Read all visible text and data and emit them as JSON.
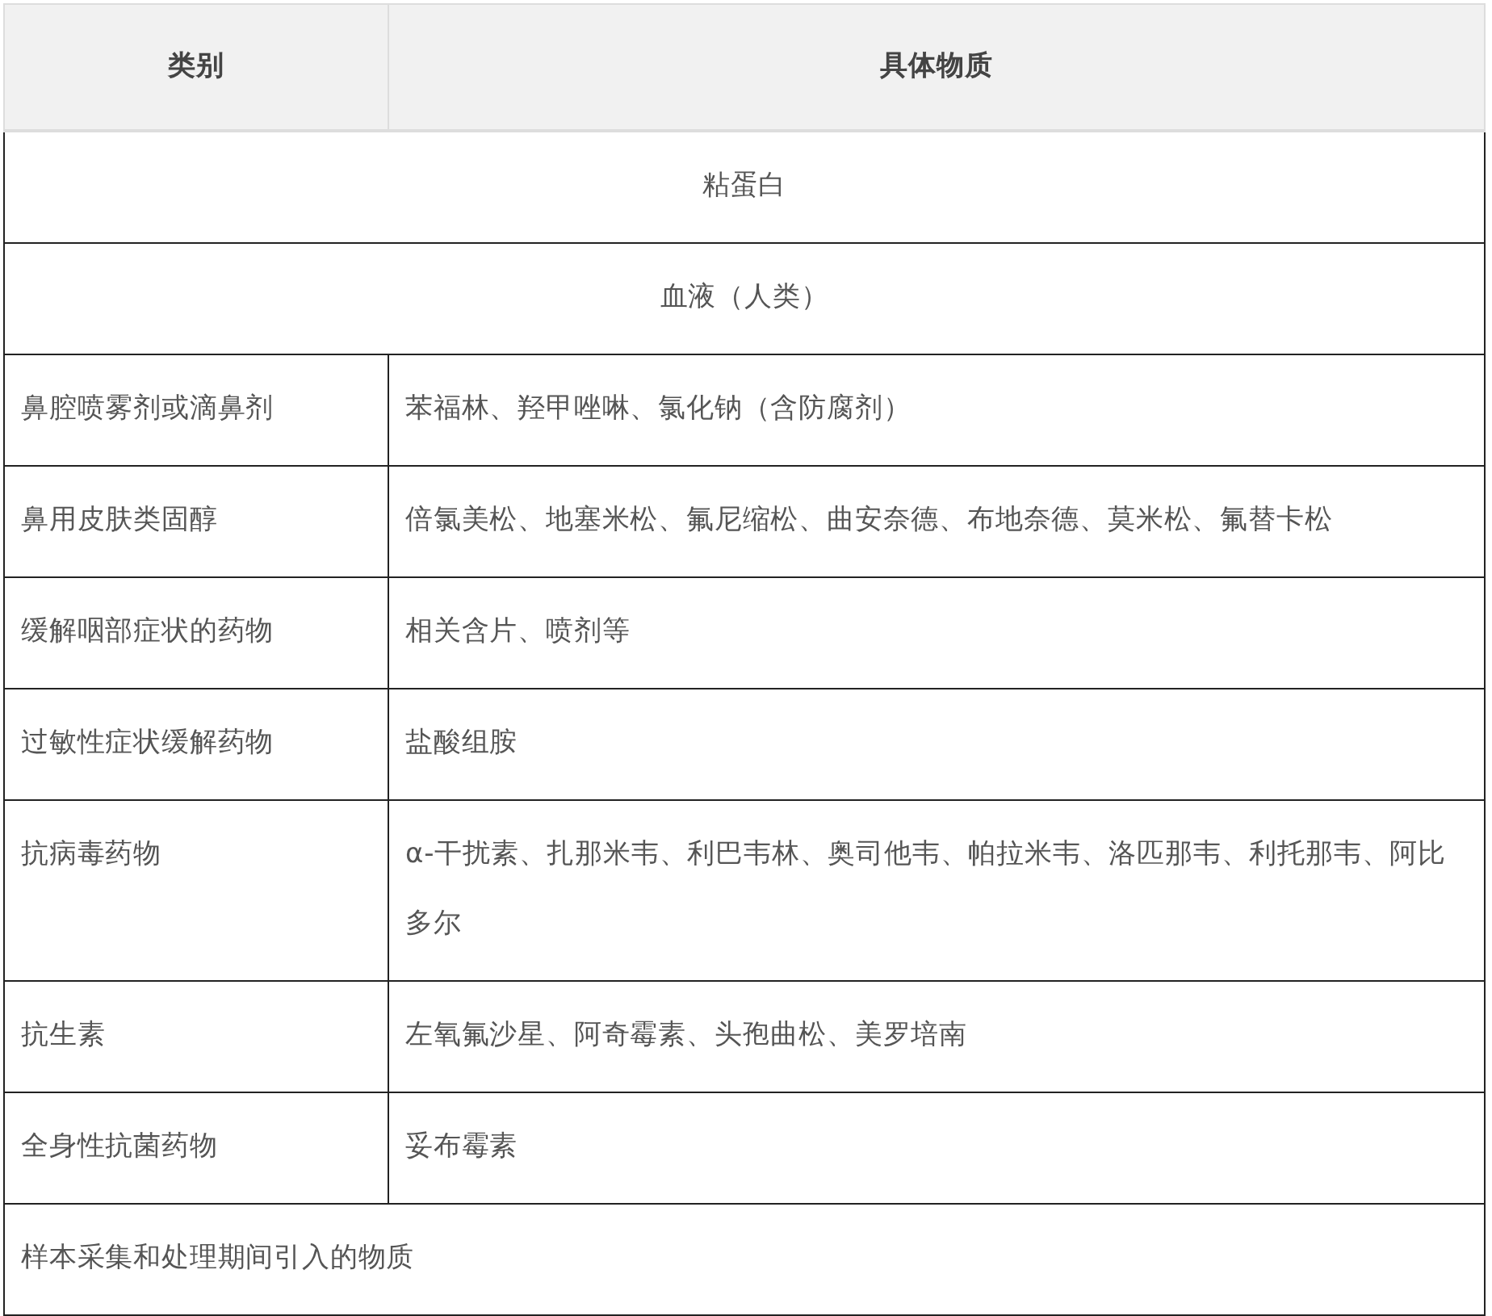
{
  "table": {
    "columns": [
      "类别",
      "具体物质"
    ],
    "rows": [
      {
        "kind": "span_center",
        "text": "粘蛋白"
      },
      {
        "kind": "span_center",
        "text": "血液（人类）"
      },
      {
        "kind": "pair",
        "category": "鼻腔喷雾剂或滴鼻剂",
        "substances": "苯福林、羟甲唑啉、氯化钠（含防腐剂）"
      },
      {
        "kind": "pair",
        "category": "鼻用皮肤类固醇",
        "substances": "倍氯美松、地塞米松、氟尼缩松、曲安奈德、布地奈德、莫米松、氟替卡松"
      },
      {
        "kind": "pair",
        "category": "缓解咽部症状的药物",
        "substances": "相关含片、喷剂等"
      },
      {
        "kind": "pair",
        "category": "过敏性症状缓解药物",
        "substances": "盐酸组胺"
      },
      {
        "kind": "pair",
        "category": "抗病毒药物",
        "substances": "α-干扰素、扎那米韦、利巴韦林、奥司他韦、帕拉米韦、洛匹那韦、利托那韦、阿比多尔"
      },
      {
        "kind": "pair",
        "category": "抗生素",
        "substances": "左氧氟沙星、阿奇霉素、头孢曲松、美罗培南"
      },
      {
        "kind": "pair",
        "category": "全身性抗菌药物",
        "substances": "妥布霉素"
      },
      {
        "kind": "span_left",
        "label": "样本采集和处理期间引入的物质"
      }
    ]
  }
}
